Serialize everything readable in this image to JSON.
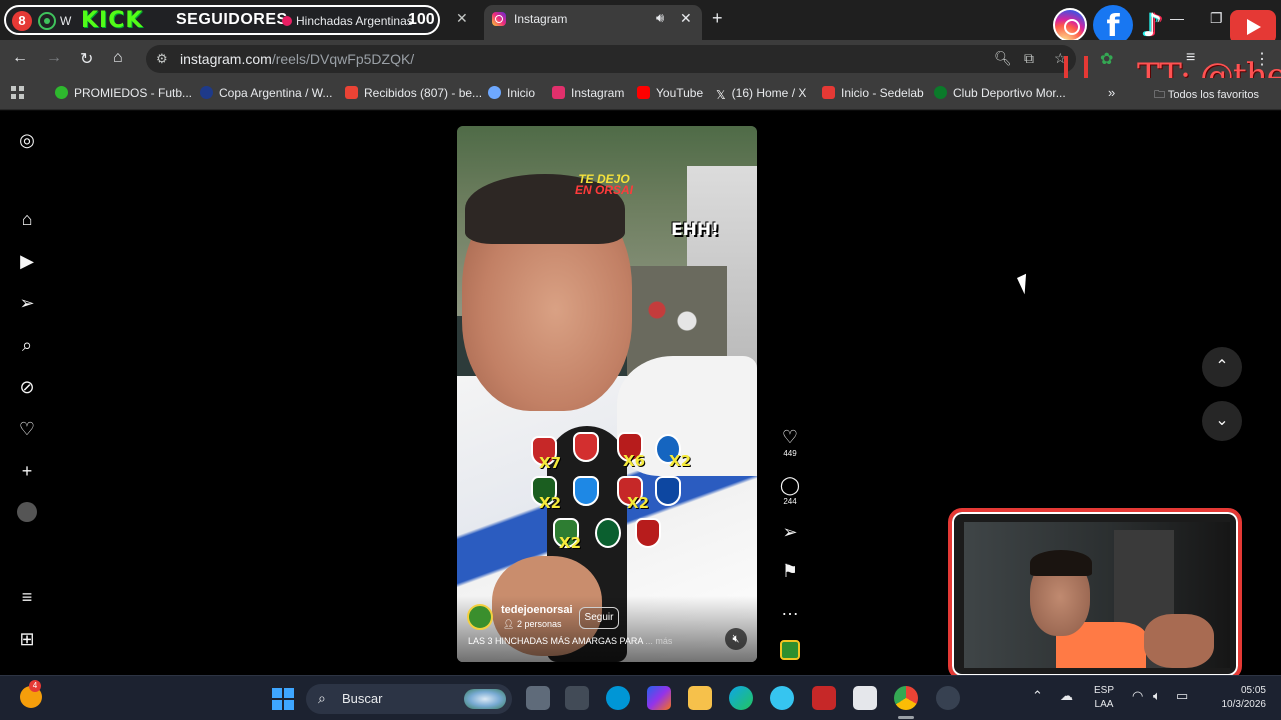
{
  "browser": {
    "tabs": {
      "first": {
        "badge": "8",
        "whatsapp_title": "W",
        "kick": "KICK",
        "seguidores": "SEGUIDORES",
        "hinchadas_title": "Hinchadas Argentinas",
        "counter": "100"
      },
      "active_title": "Instagram",
      "close_glyph": "✕",
      "new_tab_glyph": "+"
    },
    "url_host": "instagram.com",
    "url_path": "/reels/DVqwFp5DZQK/",
    "bookmarks": [
      {
        "label": "PROMIEDOS - Futb...",
        "color": "#2eb82e"
      },
      {
        "label": "Copa Argentina / W...",
        "color": "#1e3a8a"
      },
      {
        "label": "Recibidos (807) - be...",
        "color": "#ea4335"
      },
      {
        "label": "Inicio",
        "color": "#6ea8fe"
      },
      {
        "label": "Instagram",
        "color": "#e1306c"
      },
      {
        "label": "YouTube",
        "color": "#ff0000"
      },
      {
        "label": "(16) Home / X",
        "color": "#ffffff"
      },
      {
        "label": "Inicio - Sedelab",
        "color": "#e53935"
      },
      {
        "label": "Club Deportivo Mor...",
        "color": "#0b7a2a"
      }
    ],
    "bookmarks_more": "»",
    "all_bookmarks": "Todos los favoritos"
  },
  "overlay": {
    "tiktok_handle": "TT: @the",
    "accent": "#e53935"
  },
  "reel": {
    "overlay_logo_line1": "TE DEJO",
    "overlay_logo_line2": "EN ORSAI",
    "overlay_text": "EHH!",
    "crests": [
      {
        "mult": "X7",
        "color": "#c62828"
      },
      {
        "mult": "",
        "color": "#d32f2f"
      },
      {
        "mult": "X6",
        "color": "#b71c1c"
      },
      {
        "mult": "X2",
        "color": "#1565c0"
      },
      {
        "mult": "X2",
        "color": "#1b5e20"
      },
      {
        "mult": "",
        "color": "#1e88e5"
      },
      {
        "mult": "X2",
        "color": "#c62828"
      },
      {
        "mult": "",
        "color": "#0d47a1"
      },
      {
        "mult": "X2",
        "color": "#2e7d32"
      },
      {
        "mult": "",
        "color": "#0b5f2f"
      },
      {
        "mult": "",
        "color": "#b71c1c"
      }
    ],
    "account": "tedejoenorsai",
    "account_sub": "2 personas",
    "follow_label": "Seguir",
    "caption": "LAS 3 HINCHADAS MÁS AMARGAS PARA ",
    "caption_more": "... más",
    "likes": "449",
    "comments": "244"
  },
  "taskbar": {
    "weather_badge": "4",
    "search_placeholder": "Buscar",
    "lang_line1": "ESP",
    "lang_line2": "LAA",
    "time": "05:05",
    "date": "10/3/2026"
  },
  "colors": {
    "ig_background": "#000000",
    "chrome_toolbar": "#3c3c3c"
  }
}
